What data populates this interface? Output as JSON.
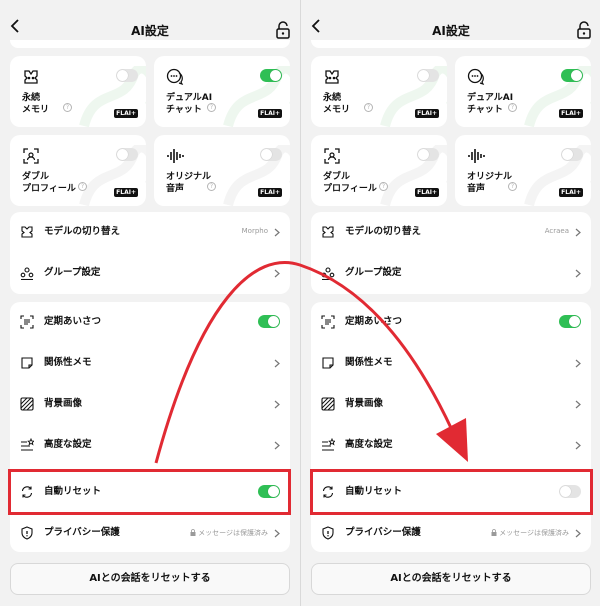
{
  "header": {
    "title": "AI設定"
  },
  "cards": [
    {
      "label": "永続\nメモリ",
      "badge": "FLAI+",
      "help": "?"
    },
    {
      "label": "デュアルAI\nチャット",
      "badge": "FLAI+",
      "help": "?"
    },
    {
      "label": "ダブル\nプロフィール",
      "badge": "FLAI+",
      "help": "?"
    },
    {
      "label": "オリジナル\n音声",
      "badge": "FLAI+",
      "help": "?"
    }
  ],
  "left": {
    "card_toggles": {
      "memory": "off",
      "dual": "on",
      "double": "off",
      "voice": "off"
    },
    "model_value": "Morpho",
    "auto_reset": "on"
  },
  "right": {
    "card_toggles": {
      "memory": "off",
      "dual": "on",
      "double": "off",
      "voice": "off"
    },
    "model_value": "Acraea",
    "auto_reset": "off"
  },
  "rows": {
    "model": "モデルの切り替え",
    "group": "グループ設定",
    "greeting": "定期あいさつ",
    "relation": "関係性メモ",
    "background": "背景画像",
    "advanced": "高度な設定",
    "auto_reset": "自動リセット",
    "privacy": "プライバシー保護",
    "privacy_value": "メッセージは保護済み"
  },
  "reset_button": "AIとの会話をリセットする",
  "colors": {
    "toggle_on": "#2fbf55",
    "highlight": "#e12a33",
    "background": "#f2f2f2"
  }
}
